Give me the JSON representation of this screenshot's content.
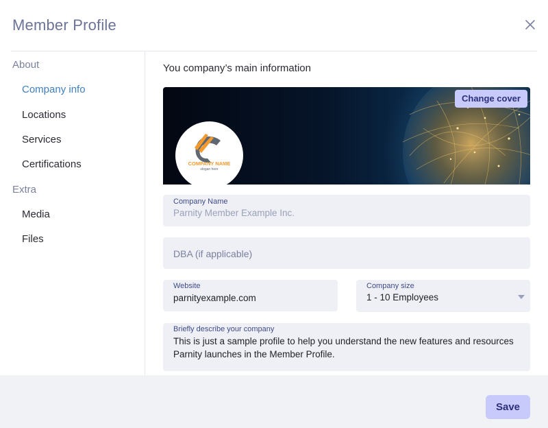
{
  "modal": {
    "title": "Member Profile"
  },
  "sidebar": {
    "sections": [
      {
        "label": "About",
        "items": [
          {
            "label": "Company info",
            "active": true
          },
          {
            "label": "Locations"
          },
          {
            "label": "Services"
          },
          {
            "label": "Certifications"
          }
        ]
      },
      {
        "label": "Extra",
        "items": [
          {
            "label": "Media"
          },
          {
            "label": "Files"
          }
        ]
      }
    ]
  },
  "main": {
    "heading": "You company’s main information",
    "change_cover_label": "Change cover",
    "logo": {
      "name": "COMPANY NAME",
      "slogan": "slogan here"
    },
    "fields": {
      "company_name": {
        "label": "Company Name",
        "placeholder": "Parnity Member Example Inc."
      },
      "dba": {
        "placeholder": "DBA  (if applicable)"
      },
      "website": {
        "label": "Website",
        "value": "parnityexample.com"
      },
      "company_size": {
        "label": "Company size",
        "value": "1 - 10 Employees"
      },
      "description": {
        "label": "Briefly describe your company",
        "value": "This is just a sample profile to help you understand the new features and resources Parnity launches in the Member Profile."
      }
    }
  },
  "footer": {
    "save_label": "Save"
  },
  "colors": {
    "accent": "#3e7fc0",
    "button_bg": "#c7cafb",
    "button_text": "#2c2f7a",
    "field_bg": "#eff0f5",
    "logo_orange": "#f29a2e",
    "logo_gray": "#5f6770"
  }
}
